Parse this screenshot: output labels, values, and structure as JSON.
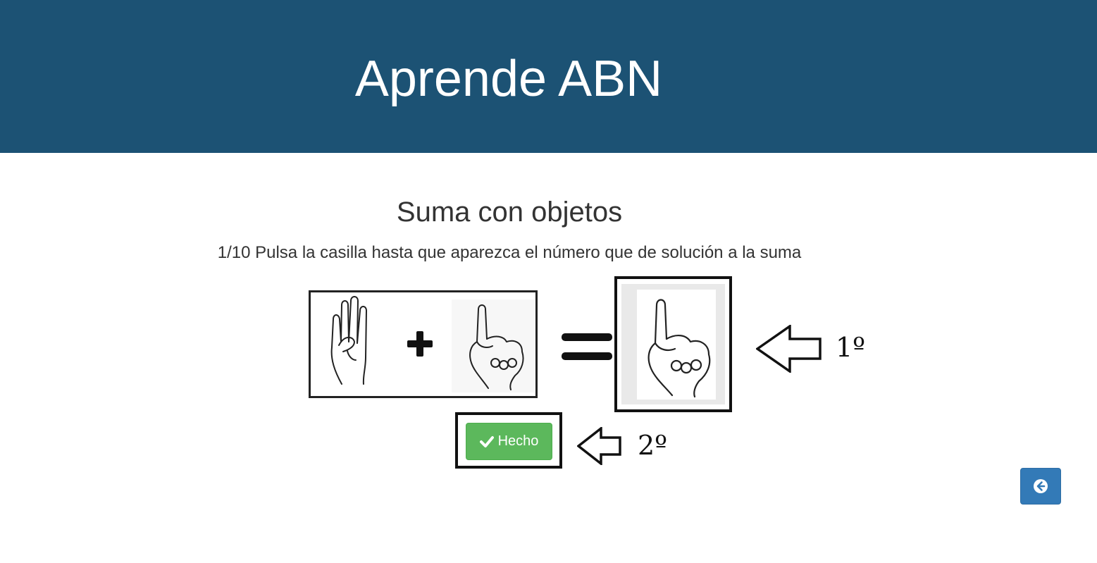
{
  "header": {
    "title": "Aprende ABN"
  },
  "exercise": {
    "title": "Suma con objetos",
    "instruction": "1/10 Pulsa la casilla hasta que aparezca el número que de solución a la suma",
    "operands": [
      "4 fingers hand sign",
      "1 finger hand sign"
    ],
    "operator": "+",
    "equals": "=",
    "selected_answer": "1 finger hand sign"
  },
  "annotations": {
    "step1": "1º",
    "step2": "2º"
  },
  "buttons": {
    "done_label": "Hecho",
    "done_icon": "check-icon",
    "back_icon": "arrow-circle-left-icon"
  },
  "colors": {
    "header_bg": "#1c5274",
    "done_bg": "#5cb85c",
    "back_bg": "#337ab7"
  }
}
